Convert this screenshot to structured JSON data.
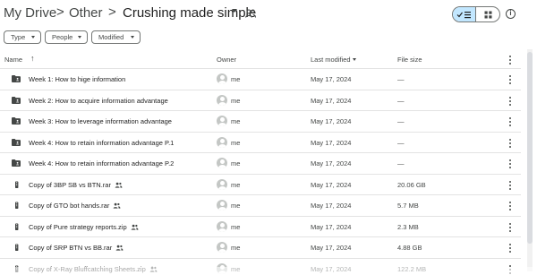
{
  "breadcrumb": {
    "root": "My Drive",
    "middle": "Other",
    "current": "Crushing made simple",
    "separator": ">"
  },
  "filters": [
    {
      "label": "Type"
    },
    {
      "label": "People"
    },
    {
      "label": "Modified"
    }
  ],
  "columns": {
    "name": "Name",
    "owner": "Owner",
    "modified": "Last modified",
    "size": "File size"
  },
  "rows": [
    {
      "kind": "folder",
      "name": "Week 1: How to hige information",
      "shared": false,
      "owner": "me",
      "modified": "May 17, 2024",
      "size": "—"
    },
    {
      "kind": "folder",
      "name": "Week 2: How to acquire information advantage",
      "shared": false,
      "owner": "me",
      "modified": "May 17, 2024",
      "size": "—"
    },
    {
      "kind": "folder",
      "name": "Week 3: How to leverage information advantage",
      "shared": false,
      "owner": "me",
      "modified": "May 17, 2024",
      "size": "—"
    },
    {
      "kind": "folder",
      "name": "Week 4: How to retain information advantage P.1",
      "shared": false,
      "owner": "me",
      "modified": "May 17, 2024",
      "size": "—"
    },
    {
      "kind": "folder",
      "name": "Week 4: How to retain information advantage P.2",
      "shared": false,
      "owner": "me",
      "modified": "May 17, 2024",
      "size": "—"
    },
    {
      "kind": "archive",
      "name": "Copy of 3BP SB vs BTN.rar",
      "shared": true,
      "owner": "me",
      "modified": "May 17, 2024",
      "size": "20.06 GB"
    },
    {
      "kind": "archive",
      "name": "Copy of GTO bot hands.rar",
      "shared": true,
      "owner": "me",
      "modified": "May 17, 2024",
      "size": "5.7 MB"
    },
    {
      "kind": "archive",
      "name": "Copy of Pure strategy reports.zip",
      "shared": true,
      "owner": "me",
      "modified": "May 17, 2024",
      "size": "2.3 MB"
    },
    {
      "kind": "archive",
      "name": "Copy of SRP BTN vs BB.rar",
      "shared": true,
      "owner": "me",
      "modified": "May 17, 2024",
      "size": "4.88 GB"
    },
    {
      "kind": "archive",
      "name": "Copy of X-Ray Bluffcatching Sheets.zip",
      "shared": true,
      "owner": "me",
      "modified": "May 17, 2024",
      "size": "122.2 MB"
    }
  ],
  "colors": {
    "accent_selected": "#c2e7ff",
    "text_primary": "#1f1f1f",
    "text_secondary": "#444746",
    "divider": "#e3e3e3",
    "folder_icon": "#444746"
  },
  "icons": {
    "share": "people-icon",
    "list_view": "checkmark-list-icon",
    "grid_view": "grid-icon",
    "info": "info-icon",
    "sort": "arrow-up-icon",
    "more": "more-vert-icon",
    "folder": "folder-person-icon",
    "archive": "zip-file-icon"
  }
}
